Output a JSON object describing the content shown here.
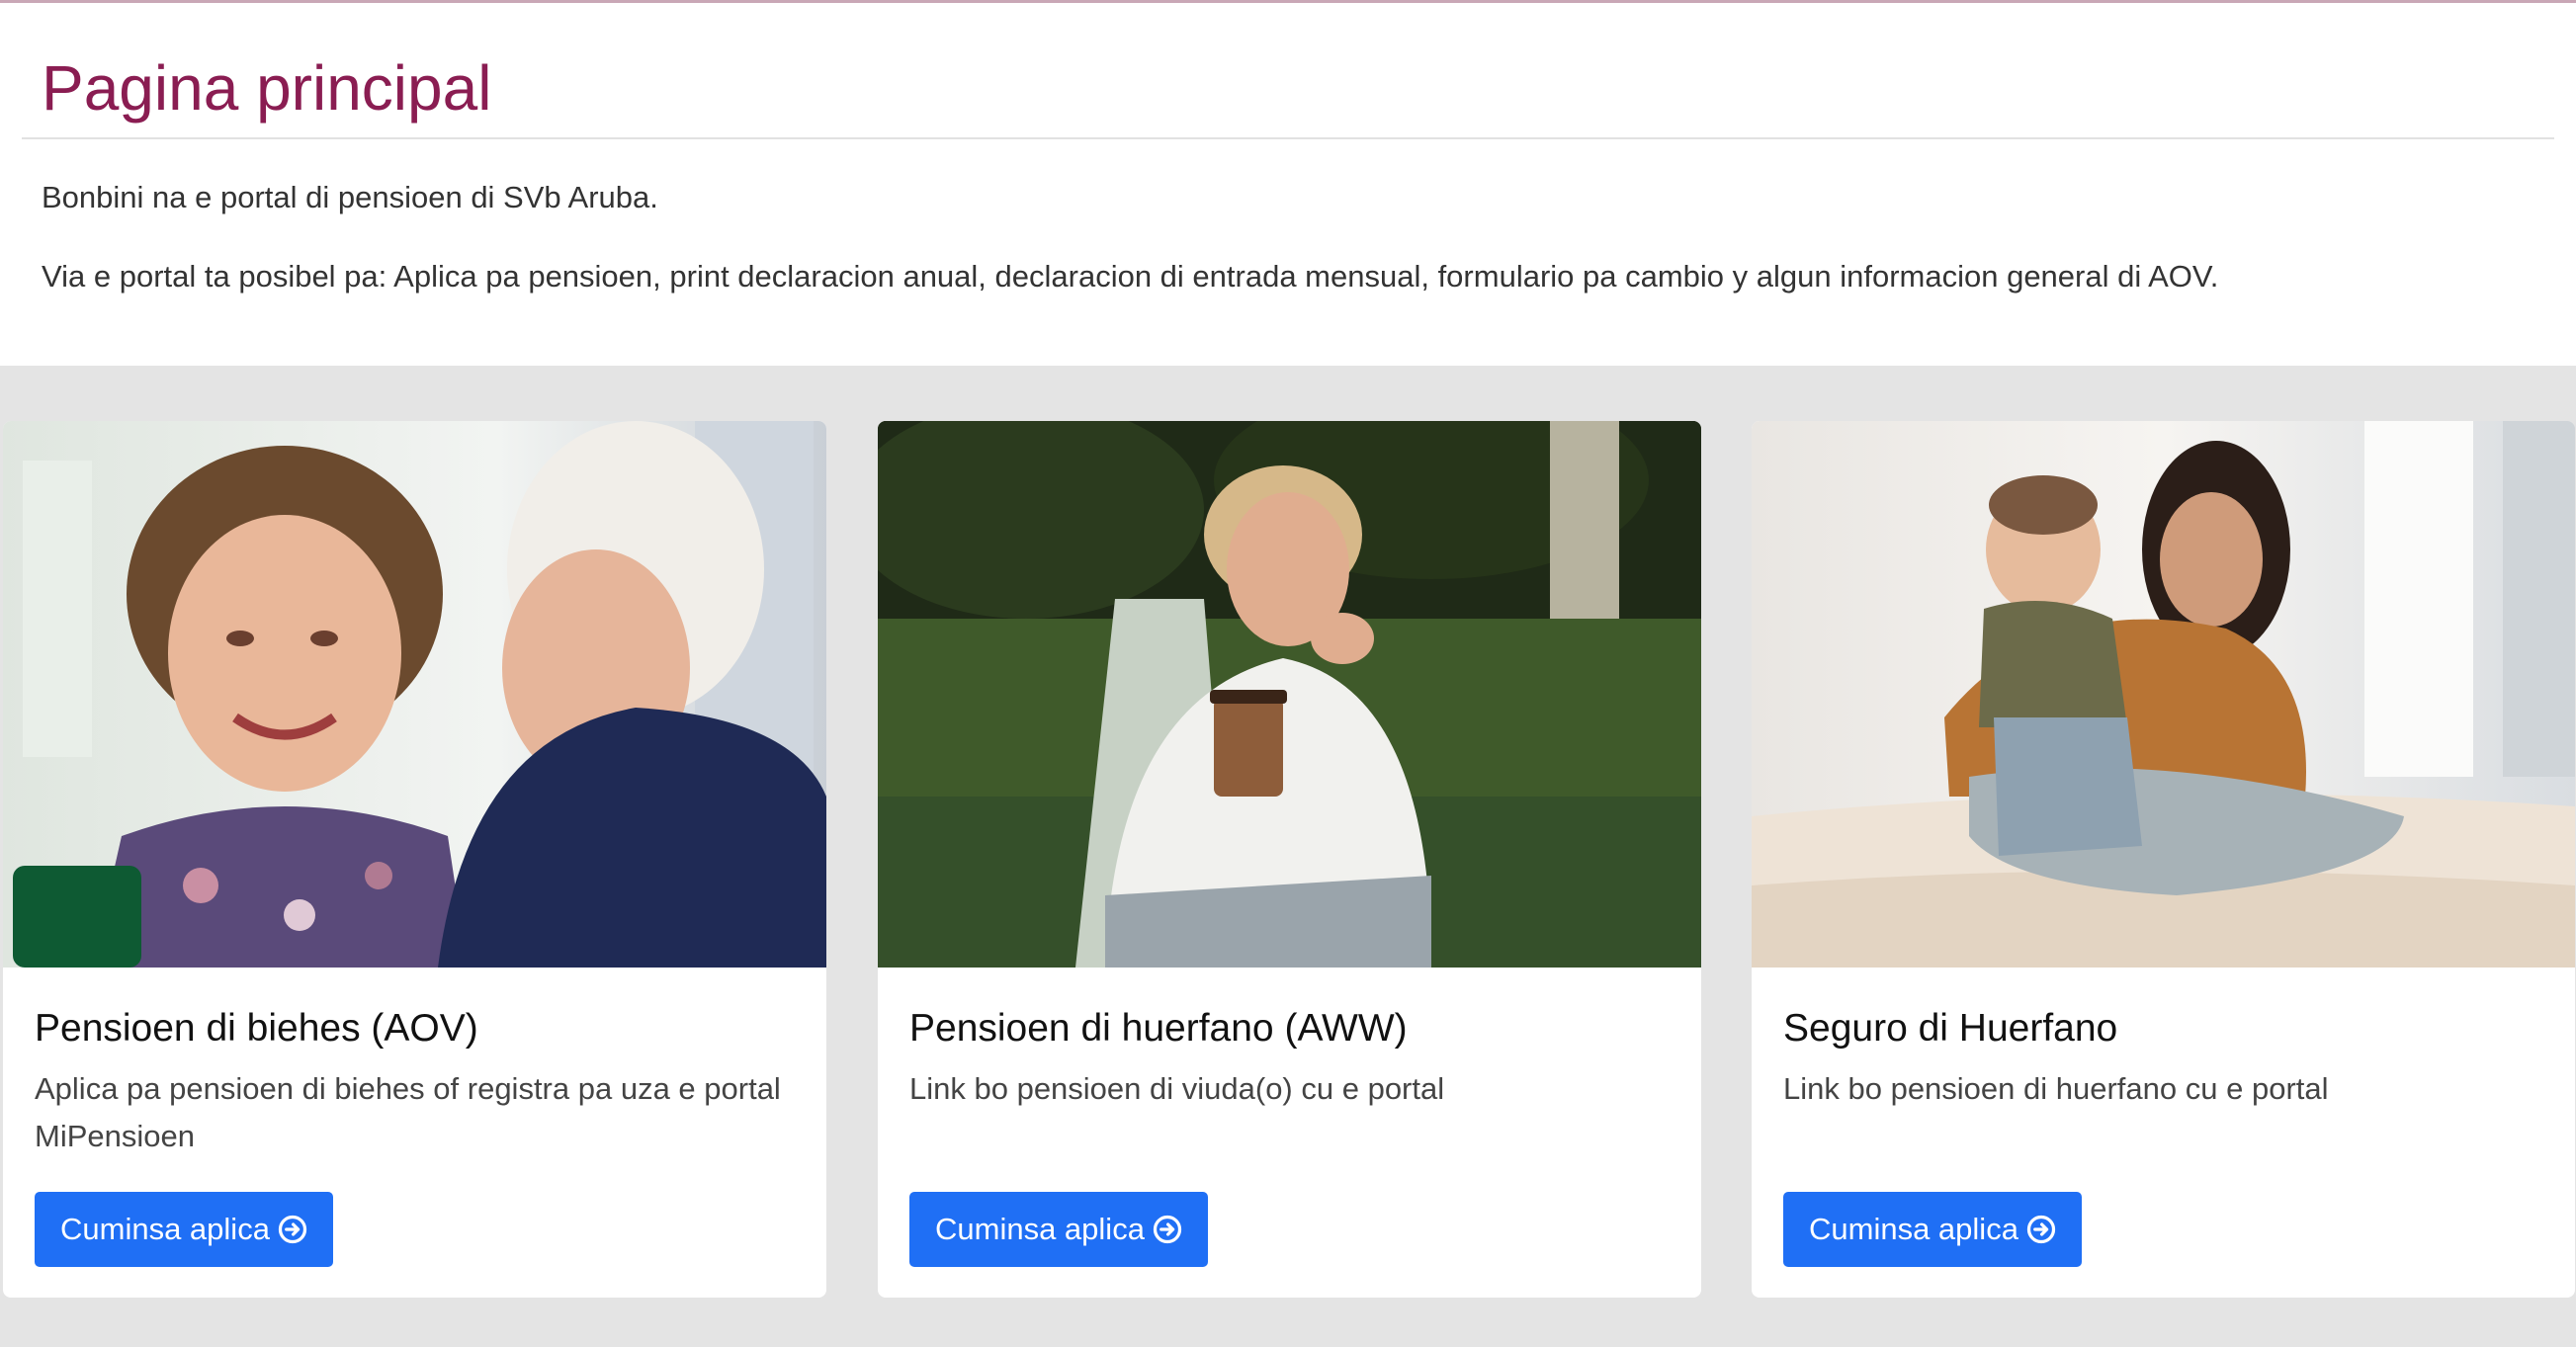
{
  "intro": {
    "title": "Pagina principal",
    "welcome": "Bonbini na e portal di pensioen di SVb Aruba.",
    "description": "Via e portal ta posibel pa: Aplica pa pensioen, print declaracion anual, declaracion di entrada mensual, formulario pa cambio y algun informacion general di AOV."
  },
  "cards": [
    {
      "title": "Pensioen di biehes (AOV)",
      "text": "Aplica pa pensioen di biehes of registra pa uza e portal MiPensioen",
      "button_label": "Cuminsa aplica",
      "button_icon": "arrow-circle-right-icon"
    },
    {
      "title": "Pensioen di huerfano (AWW)",
      "text": "Link bo pensioen di viuda(o) cu e portal",
      "button_label": "Cuminsa aplica",
      "button_icon": "arrow-circle-right-icon"
    },
    {
      "title": "Seguro di Huerfano",
      "text": "Link bo pensioen di huerfano cu e portal",
      "button_label": "Cuminsa aplica",
      "button_icon": "arrow-circle-right-icon"
    }
  ],
  "colors": {
    "title": "#8a1d52",
    "button": "#1f6ff5",
    "background": "#e4e4e4"
  }
}
